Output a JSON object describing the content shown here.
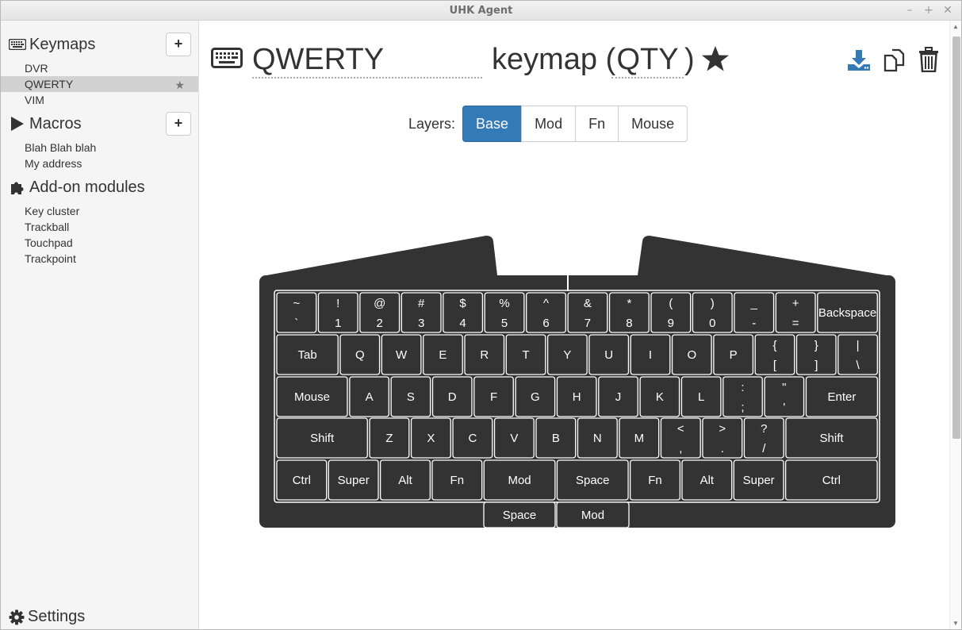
{
  "window": {
    "title": "UHK Agent",
    "buttons": [
      "–",
      "+",
      "✕"
    ]
  },
  "sidebar": {
    "keymaps": {
      "title": "Keymaps",
      "add": "+",
      "items": [
        {
          "label": "DVR"
        },
        {
          "label": "QWERTY",
          "active": true,
          "default_star": "★"
        },
        {
          "label": "VIM"
        }
      ]
    },
    "macros": {
      "title": "Macros",
      "add": "+",
      "items": [
        {
          "label": "Blah Blah blah"
        },
        {
          "label": "My address"
        }
      ]
    },
    "addons": {
      "title": "Add-on modules",
      "items": [
        {
          "label": "Key cluster"
        },
        {
          "label": "Trackball"
        },
        {
          "label": "Touchpad"
        },
        {
          "label": "Trackpoint"
        }
      ]
    },
    "settings": {
      "title": "Settings"
    }
  },
  "header": {
    "name": "QWERTY",
    "keymap_word": "keymap (",
    "abbrev": "QTY",
    "close_paren": ")",
    "star": "★"
  },
  "layers": {
    "label": "Layers:",
    "items": [
      "Base",
      "Mod",
      "Fn",
      "Mouse"
    ],
    "active": "Base"
  },
  "keyboard": {
    "rows": [
      [
        {
          "t": "~",
          "b": "`"
        },
        {
          "t": "!",
          "b": "1"
        },
        {
          "t": "@",
          "b": "2"
        },
        {
          "t": "#",
          "b": "3"
        },
        {
          "t": "$",
          "b": "4"
        },
        {
          "t": "%",
          "b": "5"
        },
        {
          "t": "^",
          "b": "6"
        },
        {
          "t": "&",
          "b": "7"
        },
        {
          "t": "*",
          "b": "8"
        },
        {
          "t": "(",
          "b": "9"
        },
        {
          "t": ")",
          "b": "0"
        },
        {
          "t": "_",
          "b": "-"
        },
        {
          "t": "+",
          "b": "="
        },
        {
          "l": "Backspace"
        }
      ],
      [
        {
          "l": "Tab"
        },
        {
          "l": "Q"
        },
        {
          "l": "W"
        },
        {
          "l": "E"
        },
        {
          "l": "R"
        },
        {
          "l": "T"
        },
        {
          "l": "Y"
        },
        {
          "l": "U"
        },
        {
          "l": "I"
        },
        {
          "l": "O"
        },
        {
          "l": "P"
        },
        {
          "t": "{",
          "b": "["
        },
        {
          "t": "}",
          "b": "]"
        },
        {
          "t": "|",
          "b": "\\"
        }
      ],
      [
        {
          "l": "Mouse"
        },
        {
          "l": "A"
        },
        {
          "l": "S"
        },
        {
          "l": "D"
        },
        {
          "l": "F"
        },
        {
          "l": "G"
        },
        {
          "l": "H"
        },
        {
          "l": "J"
        },
        {
          "l": "K"
        },
        {
          "l": "L"
        },
        {
          "t": ":",
          "b": ";"
        },
        {
          "t": "\"",
          "b": "'"
        },
        {
          "l": "Enter"
        }
      ],
      [
        {
          "l": "Shift"
        },
        {
          "l": "Z"
        },
        {
          "l": "X"
        },
        {
          "l": "C"
        },
        {
          "l": "V"
        },
        {
          "l": "B"
        },
        {
          "l": "N"
        },
        {
          "l": "M"
        },
        {
          "t": "<",
          "b": ","
        },
        {
          "t": ">",
          "b": "."
        },
        {
          "t": "?",
          "b": "/"
        },
        {
          "l": "Shift"
        }
      ],
      [
        {
          "l": "Ctrl"
        },
        {
          "l": "Super"
        },
        {
          "l": "Alt"
        },
        {
          "l": "Fn"
        },
        {
          "l": "Mod"
        },
        {
          "l": "Space"
        },
        {
          "l": "Fn"
        },
        {
          "l": "Alt"
        },
        {
          "l": "Super"
        },
        {
          "l": "Ctrl"
        }
      ],
      [
        {
          "l": "Space"
        },
        {
          "l": "Mod"
        }
      ]
    ]
  },
  "colors": {
    "accent": "#337ab7",
    "keyboard_body": "#333333",
    "key_border": "#ffffff"
  }
}
